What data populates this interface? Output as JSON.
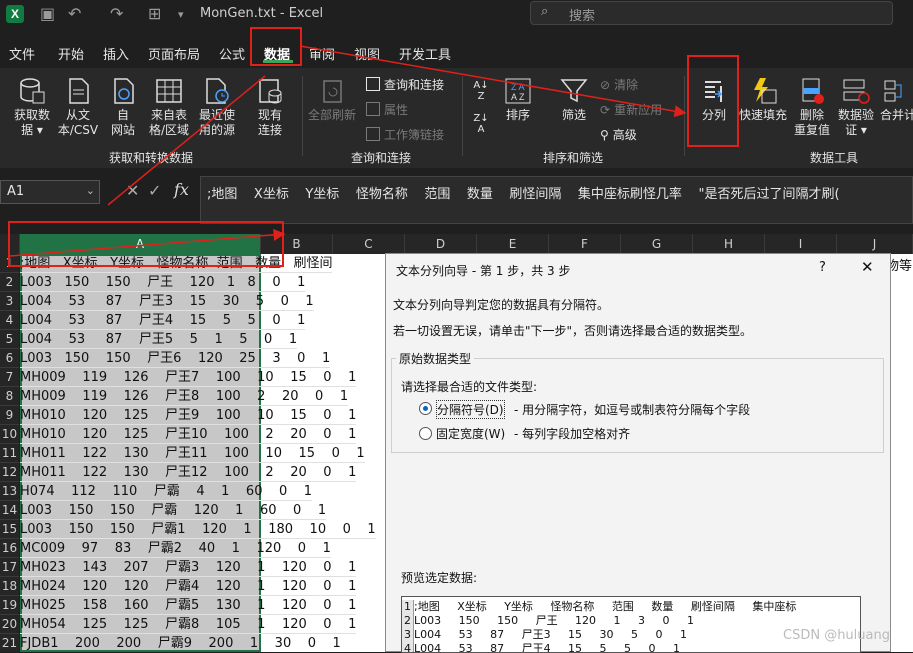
{
  "titlebar": {
    "app_icon": "X",
    "title": "MonGen.txt  -  Excel",
    "search_placeholder": "搜索",
    "search_icon": "search-icon"
  },
  "menu": [
    "文件",
    "开始",
    "插入",
    "页面布局",
    "公式",
    "数据",
    "审阅",
    "视图",
    "开发工具"
  ],
  "active_menu": "数据",
  "ribbon": {
    "get_data": "获取数\n据 ▾",
    "from_text": "从文\n本/CSV",
    "from_web": "自\n网站",
    "from_table": "来自表\n格/区域",
    "recent_sources": "最近使\n用的源",
    "existing_conn": "现有\n连接",
    "group1": "获取和转换数据",
    "refresh_all": "全部刷新",
    "queries_conn": "查询和连接",
    "properties": "属性",
    "workbook_links": "工作簿链接",
    "group2": "查询和连接",
    "sort": "排序",
    "filter": "筛选",
    "clear": "清除",
    "reapply": "重新应用",
    "advanced": "高级",
    "group3": "排序和筛选",
    "text_to_columns": "分列",
    "flash_fill": "快速填充",
    "remove_dup": "删除\n重复值",
    "data_validation": "数据验\n证 ▾",
    "consolidate": "合并计",
    "group4": "数据工具"
  },
  "formula": {
    "name_box": "A1",
    "fx": "fx",
    "content": ";地图    X坐标    Y坐标    怪物名称    范围    数量    刷怪间隔    集中座标刷怪几率    \"是否死后过了间隔才刷("
  },
  "grid": {
    "columns": [
      "A",
      "B",
      "C",
      "D",
      "E",
      "F",
      "G",
      "H",
      "I",
      "J"
    ],
    "rows": [
      {
        "n": "1",
        "text": ";地图   X坐标   Y坐标   怪物名称  范围   数量   刷怪间"
      },
      {
        "n": "2",
        "text": "L003   150    150    尸王    120   1   8    0    1"
      },
      {
        "n": "3",
        "text": "L004    53     87    尸王3    15    30    5    0    1"
      },
      {
        "n": "4",
        "text": "L004    53     87    尸王4    15    5    5    0    1"
      },
      {
        "n": "5",
        "text": "L004    53     87    尸王5    5    1    5    0    1"
      },
      {
        "n": "6",
        "text": "L003   150    150    尸王6    120    25    3    0    1"
      },
      {
        "n": "7",
        "text": "MH009    119    126    尸王7    100    10    15    0    1"
      },
      {
        "n": "8",
        "text": "MH009    119    126    尸王8    100    2    20    0    1"
      },
      {
        "n": "9",
        "text": "MH010    120    125    尸王9    100    10    15    0    1"
      },
      {
        "n": "10",
        "text": "MH010    120    125    尸王10    100    2    20    0    1"
      },
      {
        "n": "11",
        "text": "MH011    122    130    尸王11    100    10    15    0    1"
      },
      {
        "n": "12",
        "text": "MH011    122    130    尸王12    100    2    20    0    1"
      },
      {
        "n": "13",
        "text": "H074    112    110    尸霸    4    1    60    0    1"
      },
      {
        "n": "14",
        "text": "L003    150    150    尸霸    120    1    60    0    1"
      },
      {
        "n": "15",
        "text": "L003    150    150    尸霸1    120    1    180    10    0    1"
      },
      {
        "n": "16",
        "text": "MC009    97    83    尸霸2    40    1    120    0    1"
      },
      {
        "n": "17",
        "text": "MH023    143    207    尸霸3    120    1    120    0    1"
      },
      {
        "n": "18",
        "text": "MH024    120    120    尸霸4    120    1    120    0    1"
      },
      {
        "n": "19",
        "text": "MH025    158    160    尸霸5    130    1    120    0    1"
      },
      {
        "n": "20",
        "text": "MH054    125    125    尸霸8    105    1    120    0    1"
      },
      {
        "n": "21",
        "text": "FJDB1    200    200    尸霸9    200    1    30    0    1"
      }
    ],
    "right_overflow_text": "物等"
  },
  "dialog": {
    "title": "文本分列向导 - 第 1 步，共 3 步",
    "help": "?",
    "close": "✕",
    "line1": "文本分列向导判定您的数据具有分隔符。",
    "line2": "若一切设置无误，请单击\"下一步\"，否则请选择最合适的数据类型。",
    "group_label": "原始数据类型",
    "choose_label": "请选择最合适的文件类型:",
    "opt1": "分隔符号(D)",
    "opt1_desc": "- 用分隔字符，如逗号或制表符分隔每个字段",
    "opt2": "固定宽度(W)",
    "opt2_desc": "- 每列字段加空格对齐",
    "preview_label": "预览选定数据:",
    "preview_rows": [
      {
        "n": "1",
        "text": ";地图     X坐标     Y坐标     怪物名称     范围     数量     刷怪间隔     集中座标"
      },
      {
        "n": "2",
        "text": "L003     150     150     尸王     120     1     3     0     1"
      },
      {
        "n": "3",
        "text": "L004     53     87     尸王3     15     30     5     0     1"
      },
      {
        "n": "4",
        "text": "L004     53     87     尸王4     15     5     5     0     1"
      }
    ]
  },
  "watermark": "CSDN @huluang"
}
